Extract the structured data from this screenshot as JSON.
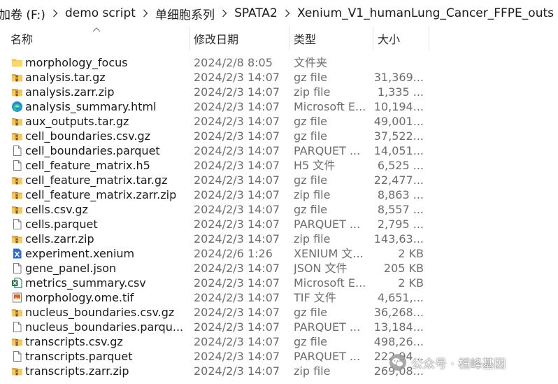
{
  "breadcrumb": [
    {
      "label": "加卷 (F:)"
    },
    {
      "label": "demo script"
    },
    {
      "label": "单细胞系列"
    },
    {
      "label": "SPATA2"
    },
    {
      "label": "Xenium_V1_humanLung_Cancer_FFPE_outs"
    }
  ],
  "columns": {
    "name": "名称",
    "date": "修改日期",
    "type": "类型",
    "size": "大小"
  },
  "files": [
    {
      "icon": "folder-icon",
      "name": "morphology_focus",
      "date": "2024/2/8 8:05",
      "type": "文件夹",
      "size": ""
    },
    {
      "icon": "archive-icon",
      "name": "analysis.tar.gz",
      "date": "2024/2/3 14:07",
      "type": "gz file",
      "size": "31,369..."
    },
    {
      "icon": "archive-icon",
      "name": "analysis.zarr.zip",
      "date": "2024/2/3 14:07",
      "type": "zip file",
      "size": "1,335 ..."
    },
    {
      "icon": "edge-icon",
      "name": "analysis_summary.html",
      "date": "2024/2/3 14:07",
      "type": "Microsoft E...",
      "size": "10,194..."
    },
    {
      "icon": "archive-icon",
      "name": "aux_outputs.tar.gz",
      "date": "2024/2/3 14:07",
      "type": "gz file",
      "size": "49,001..."
    },
    {
      "icon": "archive-icon",
      "name": "cell_boundaries.csv.gz",
      "date": "2024/2/3 14:07",
      "type": "gz file",
      "size": "37,522..."
    },
    {
      "icon": "document-icon",
      "name": "cell_boundaries.parquet",
      "date": "2024/2/3 14:07",
      "type": "PARQUET ...",
      "size": "14,051..."
    },
    {
      "icon": "document-icon",
      "name": "cell_feature_matrix.h5",
      "date": "2024/2/3 14:07",
      "type": "H5 文件",
      "size": "6,525 ..."
    },
    {
      "icon": "archive-icon",
      "name": "cell_feature_matrix.tar.gz",
      "date": "2024/2/3 14:07",
      "type": "gz file",
      "size": "22,477..."
    },
    {
      "icon": "archive-icon",
      "name": "cell_feature_matrix.zarr.zip",
      "date": "2024/2/3 14:07",
      "type": "zip file",
      "size": "8,863 ..."
    },
    {
      "icon": "archive-icon",
      "name": "cells.csv.gz",
      "date": "2024/2/3 14:07",
      "type": "gz file",
      "size": "8,557 ..."
    },
    {
      "icon": "document-icon",
      "name": "cells.parquet",
      "date": "2024/2/3 14:07",
      "type": "PARQUET ...",
      "size": "2,795 ..."
    },
    {
      "icon": "archive-icon",
      "name": "cells.zarr.zip",
      "date": "2024/2/3 14:07",
      "type": "zip file",
      "size": "143,63..."
    },
    {
      "icon": "xenium-icon",
      "name": "experiment.xenium",
      "date": "2024/2/6 1:26",
      "type": "XENIUM 文...",
      "size": "2 KB"
    },
    {
      "icon": "document-icon",
      "name": "gene_panel.json",
      "date": "2024/2/3 14:07",
      "type": "JSON 文件",
      "size": "205 KB"
    },
    {
      "icon": "excel-icon",
      "name": "metrics_summary.csv",
      "date": "2024/2/3 14:07",
      "type": "Microsoft E...",
      "size": "2 KB"
    },
    {
      "icon": "image-file-icon",
      "name": "morphology.ome.tif",
      "date": "2024/2/3 14:07",
      "type": "TIF 文件",
      "size": "4,651,..."
    },
    {
      "icon": "archive-icon",
      "name": "nucleus_boundaries.csv.gz",
      "date": "2024/2/3 14:07",
      "type": "gz file",
      "size": "36,268..."
    },
    {
      "icon": "document-icon",
      "name": "nucleus_boundaries.parqu...",
      "date": "2024/2/3 14:07",
      "type": "PARQUET ...",
      "size": "13,184..."
    },
    {
      "icon": "archive-icon",
      "name": "transcripts.csv.gz",
      "date": "2024/2/3 14:07",
      "type": "gz file",
      "size": "498,26..."
    },
    {
      "icon": "document-icon",
      "name": "transcripts.parquet",
      "date": "2024/2/3 14:07",
      "type": "PARQUET ...",
      "size": "222,94..."
    },
    {
      "icon": "archive-icon",
      "name": "transcripts.zarr.zip",
      "date": "2024/2/3 14:07",
      "type": "zip file",
      "size": "269,08..."
    }
  ],
  "watermark": {
    "text": "公众号 · 桓峰基因"
  }
}
